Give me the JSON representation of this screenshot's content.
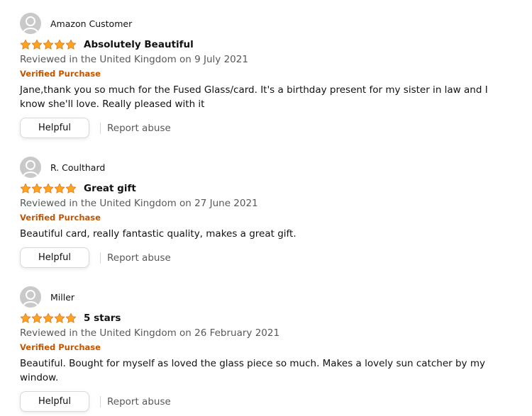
{
  "colors": {
    "star": "#ffa41c",
    "star_stroke": "#de7921",
    "verified": "#c45500",
    "meta_text": "#565959"
  },
  "reviews": [
    {
      "author": "Amazon Customer",
      "rating": 5,
      "rating_max": 5,
      "title": "Absolutely Beautiful",
      "date": "Reviewed in the United Kingdom on 9 July 2021",
      "verified": "Verified Purchase",
      "body": "Jane,thank you so much for the Fused Glass/card. It's a birthday present for my sister in law and I know she'll love. Really pleased with it",
      "helpful_label": "Helpful",
      "report_label": "Report abuse"
    },
    {
      "author": "R. Coulthard",
      "rating": 5,
      "rating_max": 5,
      "title": "Great gift",
      "date": "Reviewed in the United Kingdom on 27 June 2021",
      "verified": "Verified Purchase",
      "body": "Beautiful card, really fantastic quality, makes a great gift.",
      "helpful_label": "Helpful",
      "report_label": "Report abuse"
    },
    {
      "author": "Miller",
      "rating": 5,
      "rating_max": 5,
      "title": "5 stars",
      "date": "Reviewed in the United Kingdom on 26 February 2021",
      "verified": "Verified Purchase",
      "body": "Beautiful. Bought for myself as loved the glass piece so much. Makes a lovely sun catcher by my window.",
      "helpful_label": "Helpful",
      "report_label": "Report abuse"
    }
  ]
}
